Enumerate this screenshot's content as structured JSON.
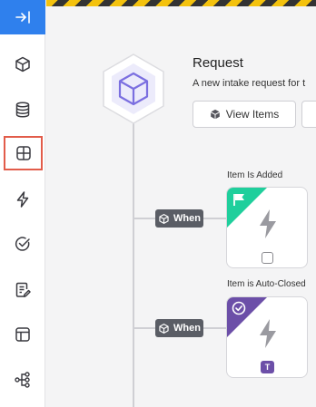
{
  "sidebar": {
    "items": [
      {
        "icon": "arrow-right-to-bar-icon",
        "label": ""
      },
      {
        "icon": "cube-icon"
      },
      {
        "icon": "database-icon"
      },
      {
        "icon": "grid-icon",
        "active": true
      },
      {
        "icon": "lightning-icon"
      },
      {
        "icon": "check-circle-icon"
      },
      {
        "icon": "form-edit-icon"
      },
      {
        "icon": "layout-icon"
      },
      {
        "icon": "workflow-icon"
      }
    ],
    "accent": "#2f80ed",
    "active_outline": "#e25c4a"
  },
  "request": {
    "title": "Request",
    "description": "A new intake request for t",
    "view_items_label": "View Items"
  },
  "triggers": [
    {
      "badge": "When",
      "label": "Item Is Added",
      "corner_color": "#1fcf9c",
      "corner_icon": "flag-icon",
      "footer": "checkbox"
    },
    {
      "badge": "When",
      "label": "Item is Auto-Closed",
      "corner_color": "#6c4fa8",
      "corner_icon": "check-circle-icon",
      "footer_text": "T"
    }
  ]
}
